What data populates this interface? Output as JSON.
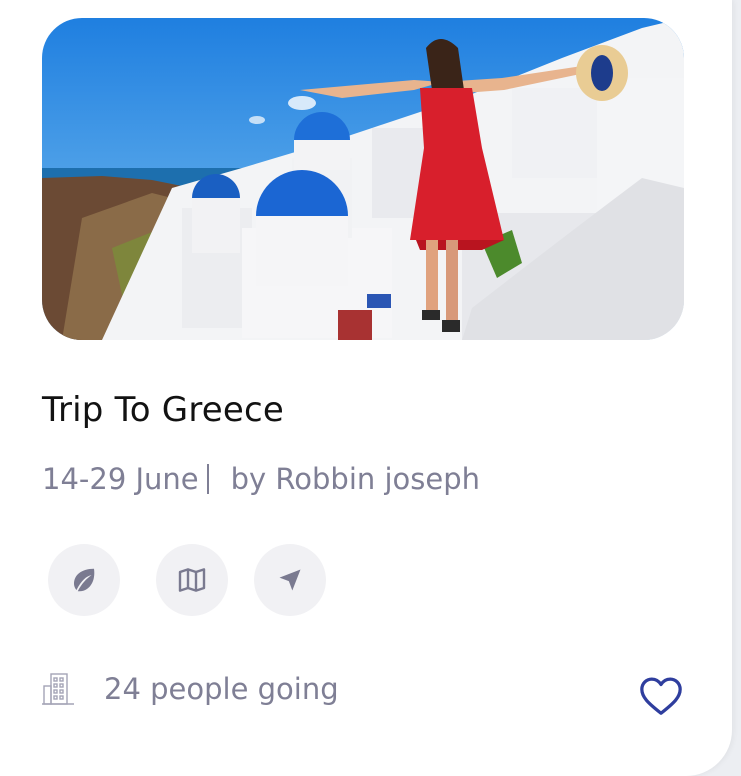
{
  "trip": {
    "title": "Trip To Greece",
    "dates": "14-29 June",
    "organizer": "by Robbin joseph",
    "attendance": "24 people going"
  },
  "photo": {
    "subject": "Santorini, woman in red dress"
  },
  "actions": [
    {
      "icon": "leaf-icon"
    },
    {
      "icon": "map-icon"
    },
    {
      "icon": "navigation-icon"
    }
  ],
  "icons": {
    "building": "building-icon",
    "favorite": "heart-icon"
  },
  "colors": {
    "title": "#121212",
    "muted": "#7f7f95",
    "icon_bg": "#f1f1f4",
    "icon": "#7a7a90",
    "heart": "#2f3e9e",
    "card": "#ffffff"
  }
}
